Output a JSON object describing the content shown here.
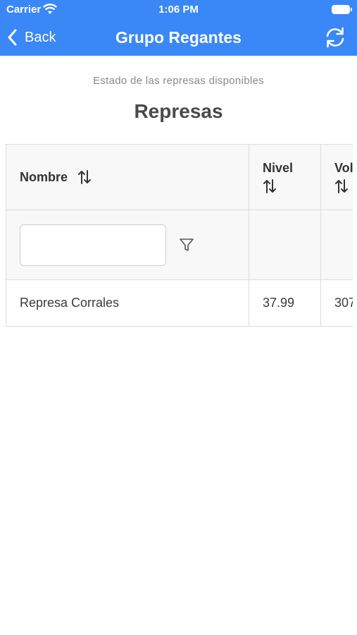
{
  "status_bar": {
    "carrier": "Carrier",
    "time": "1:06 PM"
  },
  "nav": {
    "back_label": "Back",
    "title": "Grupo Regantes"
  },
  "page": {
    "subtitle": "Estado de las represas disponibles",
    "title": "Represas"
  },
  "table": {
    "columns": [
      "Nombre",
      "Nivel",
      "Vol"
    ],
    "filter_value": "",
    "rows": [
      {
        "nombre": "Represa Corrales",
        "nivel": "37.99",
        "volumen": "307"
      }
    ]
  },
  "colors": {
    "nav_bg": "#3a87f7",
    "header_bg": "#f8f8f8",
    "border": "#dcdcdc"
  },
  "icons": [
    "wifi-icon",
    "battery-icon",
    "chevron-left-icon",
    "refresh-icon",
    "sort-icon",
    "filter-icon"
  ]
}
